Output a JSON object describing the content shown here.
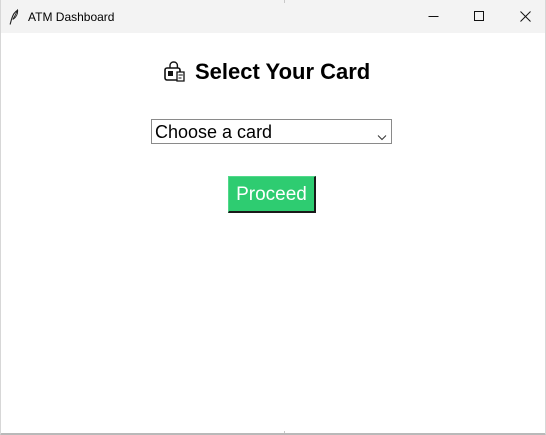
{
  "window": {
    "title": "ATM Dashboard",
    "app_icon": "feather-pen-icon",
    "controls": {
      "minimize_icon": "minimize-icon",
      "maximize_icon": "maximize-icon",
      "close_icon": "close-icon"
    }
  },
  "main": {
    "heading": {
      "icon": "credit-card-icon",
      "title": "Select Your Card"
    },
    "card_select": {
      "selected_value": "Choose a card",
      "icon": "chevron-down-icon"
    },
    "proceed_button": {
      "label": "Proceed"
    }
  },
  "colors": {
    "window_background": "#ffffff",
    "titlebar_background": "#f3f3f3",
    "button_background": "#2ecc71",
    "button_text": "#ffffff",
    "text": "#000000"
  }
}
